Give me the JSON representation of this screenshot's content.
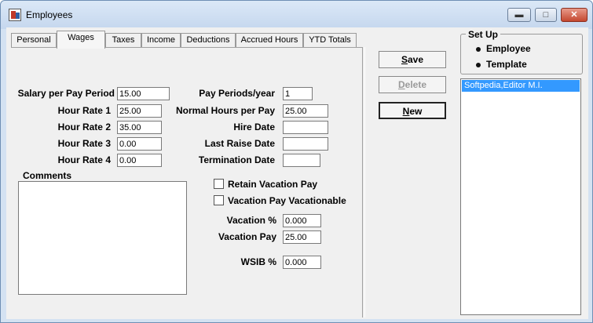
{
  "window": {
    "title": "Employees",
    "min_glyph": "▬",
    "max_glyph": "□",
    "close_glyph": "✕"
  },
  "tabs": [
    {
      "label": "Personal"
    },
    {
      "label": "Wages"
    },
    {
      "label": "Taxes"
    },
    {
      "label": "Income"
    },
    {
      "label": "Deductions"
    },
    {
      "label": "Accrued Hours"
    },
    {
      "label": "YTD Totals"
    }
  ],
  "wages": {
    "salary_per_pay_period": {
      "label": "Salary per Pay Period",
      "value": "15.00"
    },
    "hour_rate_1": {
      "label": "Hour Rate 1",
      "value": "25.00"
    },
    "hour_rate_2": {
      "label": "Hour Rate 2",
      "value": "35.00"
    },
    "hour_rate_3": {
      "label": "Hour Rate 3",
      "value": "0.00"
    },
    "hour_rate_4": {
      "label": "Hour Rate 4",
      "value": "0.00"
    },
    "pay_periods_year": {
      "label": "Pay Periods/year",
      "value": "1"
    },
    "normal_hours_per_pay": {
      "label": "Normal Hours per Pay",
      "value": "25.00"
    },
    "hire_date": {
      "label": "Hire Date",
      "value": ""
    },
    "last_raise_date": {
      "label": "Last Raise Date",
      "value": ""
    },
    "termination_date": {
      "label": "Termination Date",
      "value": ""
    },
    "comments_label": "Comments",
    "retain_vacation_pay": {
      "label": "Retain Vacation Pay",
      "checked": false
    },
    "vacation_pay_vacationable": {
      "label": "Vacation Pay Vacationable",
      "checked": false
    },
    "vacation_percent": {
      "label": "Vacation %",
      "value": "0.000"
    },
    "vacation_pay": {
      "label": "Vacation Pay",
      "value": "25.00"
    },
    "wsib_percent": {
      "label": "WSIB %",
      "value": "0.000"
    }
  },
  "buttons": {
    "save": {
      "key": "S",
      "rest": "ave"
    },
    "delete": {
      "key": "D",
      "rest": "elete"
    },
    "new": {
      "key": "N",
      "rest": "ew"
    }
  },
  "setup": {
    "title": "Set Up",
    "options": [
      {
        "label": "Employee",
        "selected": true
      },
      {
        "label": "Template",
        "selected": false
      }
    ]
  },
  "employee_list": [
    "Softpedia,Editor M.I."
  ]
}
